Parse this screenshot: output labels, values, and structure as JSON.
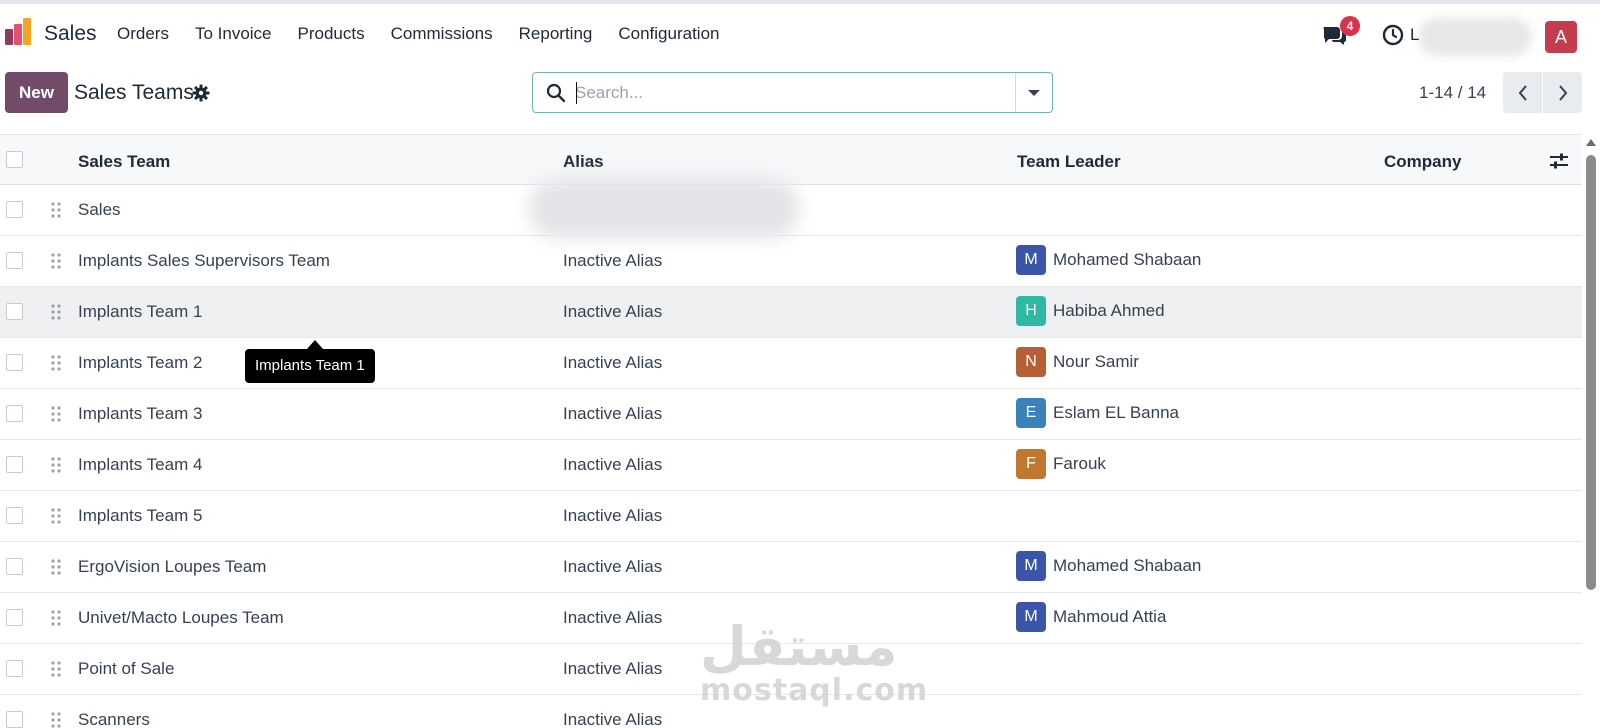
{
  "app": {
    "name": "Sales",
    "user_initial": "L",
    "avatar_letter": "A"
  },
  "menu": [
    {
      "label": "Orders"
    },
    {
      "label": "To Invoice"
    },
    {
      "label": "Products"
    },
    {
      "label": "Commissions"
    },
    {
      "label": "Reporting"
    },
    {
      "label": "Configuration"
    }
  ],
  "notifications": {
    "count": "4"
  },
  "control_panel": {
    "new_label": "New",
    "title": "Sales Teams",
    "search_placeholder": "Search...",
    "pager": "1-14 / 14"
  },
  "columns": {
    "sales_team": "Sales Team",
    "alias": "Alias",
    "team_leader": "Team Leader",
    "company": "Company"
  },
  "rows": [
    {
      "team": "Sales",
      "alias": "",
      "leader": "",
      "initial": "",
      "color": ""
    },
    {
      "team": "Implants Sales Supervisors Team",
      "alias": "Inactive Alias",
      "leader": "Mohamed Shabaan",
      "initial": "M",
      "color": "#3b56a8"
    },
    {
      "team": "Implants Team 1",
      "alias": "Inactive Alias",
      "leader": "Habiba Ahmed",
      "initial": "H",
      "color": "#2fb8a4"
    },
    {
      "team": "Implants Team 2",
      "alias": "Inactive Alias",
      "leader": "Nour Samir",
      "initial": "N",
      "color": "#b85e35"
    },
    {
      "team": "Implants Team 3",
      "alias": "Inactive Alias",
      "leader": "Eslam EL Banna",
      "initial": "E",
      "color": "#3a82b8"
    },
    {
      "team": "Implants Team 4",
      "alias": "Inactive Alias",
      "leader": "Farouk",
      "initial": "F",
      "color": "#c0772f"
    },
    {
      "team": "Implants Team 5",
      "alias": "Inactive Alias",
      "leader": "",
      "initial": "",
      "color": ""
    },
    {
      "team": "ErgoVision Loupes Team",
      "alias": "Inactive Alias",
      "leader": "Mohamed Shabaan",
      "initial": "M",
      "color": "#3b56a8"
    },
    {
      "team": "Univet/Macto Loupes Team",
      "alias": "Inactive Alias",
      "leader": "Mahmoud Attia",
      "initial": "M",
      "color": "#3b56a8"
    },
    {
      "team": "Point of Sale",
      "alias": "Inactive Alias",
      "leader": "",
      "initial": "",
      "color": ""
    },
    {
      "team": "Scanners",
      "alias": "Inactive Alias",
      "leader": "",
      "initial": "",
      "color": ""
    }
  ],
  "tooltip": "Implants Team 1",
  "watermark": {
    "arabic": "مستقل",
    "latin": "mostaql.com"
  }
}
